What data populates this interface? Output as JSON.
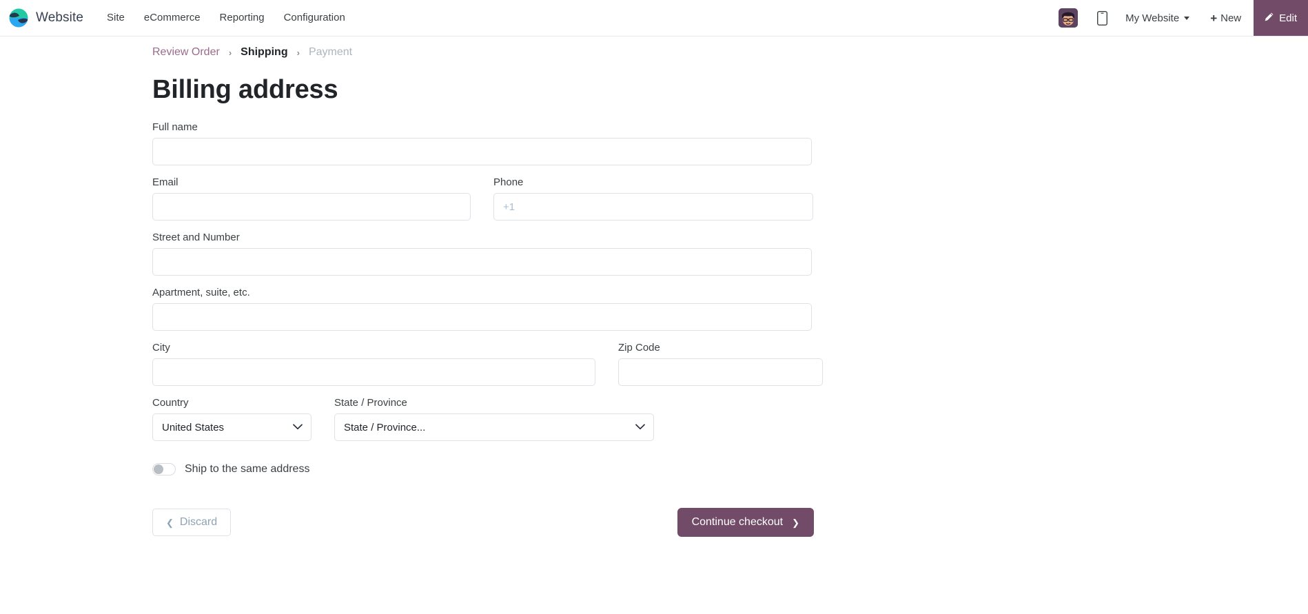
{
  "navbar": {
    "brand": "Website",
    "logo_icon": "odoo-logo-icon",
    "menu_items": [
      {
        "label": "Site"
      },
      {
        "label": "eCommerce"
      },
      {
        "label": "Reporting"
      },
      {
        "label": "Configuration"
      }
    ],
    "avatar_icon": "user-avatar",
    "mobile_icon": "mobile-preview-icon",
    "website_selector": "My Website",
    "new_label": "New",
    "new_icon": "plus-icon",
    "edit_label": "Edit",
    "edit_icon": "pencil-icon",
    "edit_bg_color": "#714b67"
  },
  "breadcrumb": {
    "separator": "›",
    "steps": [
      {
        "label": "Review Order",
        "state": "done"
      },
      {
        "label": "Shipping",
        "state": "current"
      },
      {
        "label": "Payment",
        "state": "upcoming"
      }
    ]
  },
  "main": {
    "title": "Billing address",
    "fields": {
      "full_name": {
        "label": "Full name",
        "value": "",
        "placeholder": ""
      },
      "email": {
        "label": "Email",
        "value": "",
        "placeholder": ""
      },
      "phone": {
        "label": "Phone",
        "value": "",
        "placeholder": "+1"
      },
      "street": {
        "label": "Street and Number",
        "value": "",
        "placeholder": ""
      },
      "apartment": {
        "label": "Apartment, suite, etc.",
        "value": "",
        "placeholder": ""
      },
      "city": {
        "label": "City",
        "value": "",
        "placeholder": ""
      },
      "zip": {
        "label": "Zip Code",
        "value": "",
        "placeholder": ""
      },
      "country": {
        "label": "Country",
        "value": "United States",
        "options": [
          "United States"
        ]
      },
      "state": {
        "label": "State / Province",
        "value": "State / Province...",
        "options": [
          "State / Province..."
        ]
      }
    },
    "toggle": {
      "label": "Ship to the same address",
      "checked": false
    },
    "buttons": {
      "discard": {
        "label": "Discard",
        "icon": "chevron-left-icon"
      },
      "continue": {
        "label": "Continue checkout",
        "icon": "chevron-right-icon",
        "bg_color": "#714b67"
      }
    }
  }
}
